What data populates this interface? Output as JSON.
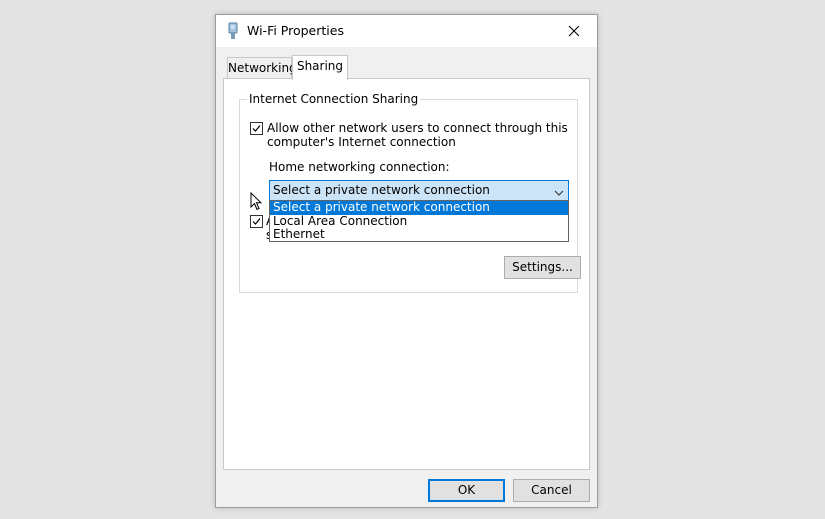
{
  "window": {
    "title": "Wi-Fi Properties",
    "close_icon": "close-icon",
    "app_icon": "wifi-adapter-icon"
  },
  "tabs": [
    {
      "label": "Networking",
      "active": false
    },
    {
      "label": "Sharing",
      "active": true
    }
  ],
  "sharing": {
    "group_title": "Internet Connection Sharing",
    "allow_connect": {
      "checked": true,
      "label_line1": "Allow other network users to connect through this",
      "label_line2": "computer's Internet connection"
    },
    "home_connection_label": "Home networking connection:",
    "combo": {
      "value": "Select a private network connection",
      "options": [
        {
          "label": "Select a private network connection",
          "selected": true
        },
        {
          "label": "Local Area Connection",
          "selected": false
        },
        {
          "label": "Ethernet",
          "selected": false
        }
      ]
    },
    "allow_control": {
      "checked": true,
      "label_partial": "A",
      "label_partial_line2": "s"
    },
    "settings_button": "Settings..."
  },
  "footer": {
    "ok_button": "OK",
    "cancel_button": "Cancel"
  },
  "colors": {
    "accent": "#0078d7",
    "combo_bg": "#cce4f7"
  }
}
